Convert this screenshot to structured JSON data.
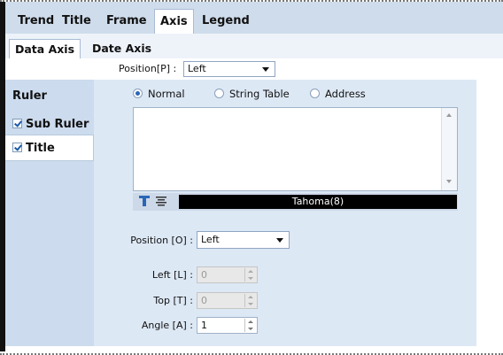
{
  "main_tabs": [
    {
      "label": "Trend",
      "active": false
    },
    {
      "label": "Title",
      "active": false
    },
    {
      "label": "Frame",
      "active": false
    },
    {
      "label": "Axis",
      "active": true
    },
    {
      "label": "Legend",
      "active": false
    }
  ],
  "sub_tabs": [
    {
      "label": "Data Axis",
      "active": true
    },
    {
      "label": "Date Axis",
      "active": false
    }
  ],
  "axis_position": {
    "label": "Position[P] :",
    "value": "Left"
  },
  "side_items": [
    {
      "label": "Ruler",
      "checked": null,
      "active": false
    },
    {
      "label": "Sub Ruler",
      "checked": true,
      "active": false
    },
    {
      "label": "Title",
      "checked": true,
      "active": true
    }
  ],
  "title_source": {
    "options": [
      {
        "label": "Normal",
        "selected": true
      },
      {
        "label": "String Table",
        "selected": false
      },
      {
        "label": "Address",
        "selected": false
      }
    ]
  },
  "title_text": {
    "value": ""
  },
  "font": {
    "value": "Tahoma(8)"
  },
  "title_position": {
    "label": "Position [O] :",
    "value": "Left"
  },
  "left": {
    "label": "Left [L] :",
    "value": "0",
    "disabled": true
  },
  "top": {
    "label": "Top [T] :",
    "value": "0",
    "disabled": true
  },
  "angle": {
    "label": "Angle [A] :",
    "value": "1",
    "disabled": false
  },
  "colors": {
    "tabbar": "#cfdcec",
    "sidepanel": "#ccdbee",
    "panel": "#dde8f5",
    "radio_on": "#2a66b8",
    "fontbox": "#000000"
  }
}
